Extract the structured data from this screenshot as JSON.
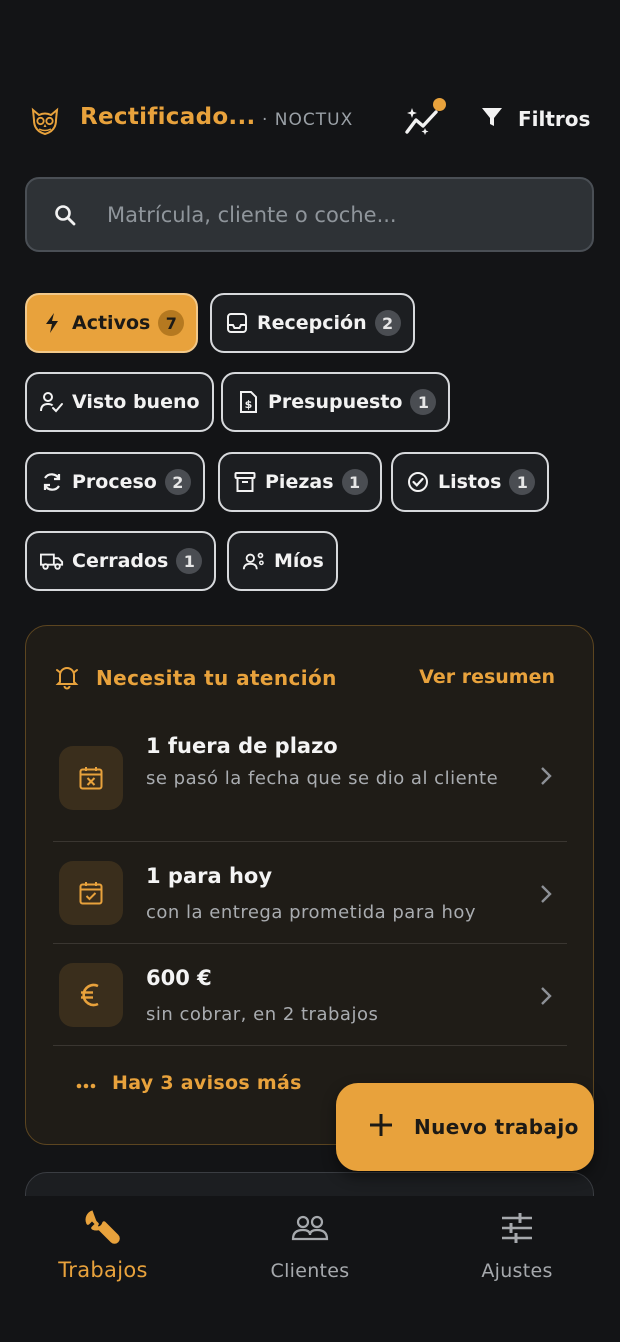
{
  "header": {
    "title": "Rectificado...",
    "brand": "· NOCTUX",
    "filter_label": "Filtros"
  },
  "search": {
    "placeholder": "Matrícula, cliente o coche..."
  },
  "chips": [
    {
      "label": "Activos",
      "count": "7",
      "icon": "bolt-icon",
      "active": true
    },
    {
      "label": "Recepción",
      "count": "2",
      "icon": "inbox-icon"
    },
    {
      "label": "Visto bueno",
      "count": "",
      "icon": "user-check-icon"
    },
    {
      "label": "Presupuesto",
      "count": "1",
      "icon": "invoice-icon"
    },
    {
      "label": "Proceso",
      "count": "2",
      "icon": "sync-icon"
    },
    {
      "label": "Piezas",
      "count": "1",
      "icon": "archive-icon"
    },
    {
      "label": "Listos",
      "count": "1",
      "icon": "check-circle-icon"
    },
    {
      "label": "Cerrados",
      "count": "1",
      "icon": "truck-icon"
    },
    {
      "label": "Míos",
      "count": "",
      "icon": "user-gear-icon"
    }
  ],
  "attention": {
    "title": "Necesita tu atención",
    "link": "Ver resumen",
    "items": [
      {
        "title": "1 fuera de plazo",
        "subtitle": "se pasó la fecha que se dio al cliente",
        "icon": "calendar-x-icon"
      },
      {
        "title": "1 para hoy",
        "subtitle": "con la entrega prometida para hoy",
        "icon": "calendar-check-icon"
      },
      {
        "title": "600 €",
        "subtitle": "sin cobrar, en 2 trabajos",
        "icon": "euro-icon"
      }
    ],
    "more": "Hay 3 avisos más"
  },
  "fab": {
    "label": "Nuevo trabajo"
  },
  "nav": [
    {
      "label": "Trabajos",
      "icon": "wrench-icon",
      "active": true
    },
    {
      "label": "Clientes",
      "icon": "users-icon"
    },
    {
      "label": "Ajustes",
      "icon": "sliders-icon"
    }
  ],
  "colors": {
    "accent": "#e8a23c",
    "background": "#131416",
    "chip_border": "#d7d9dc"
  }
}
